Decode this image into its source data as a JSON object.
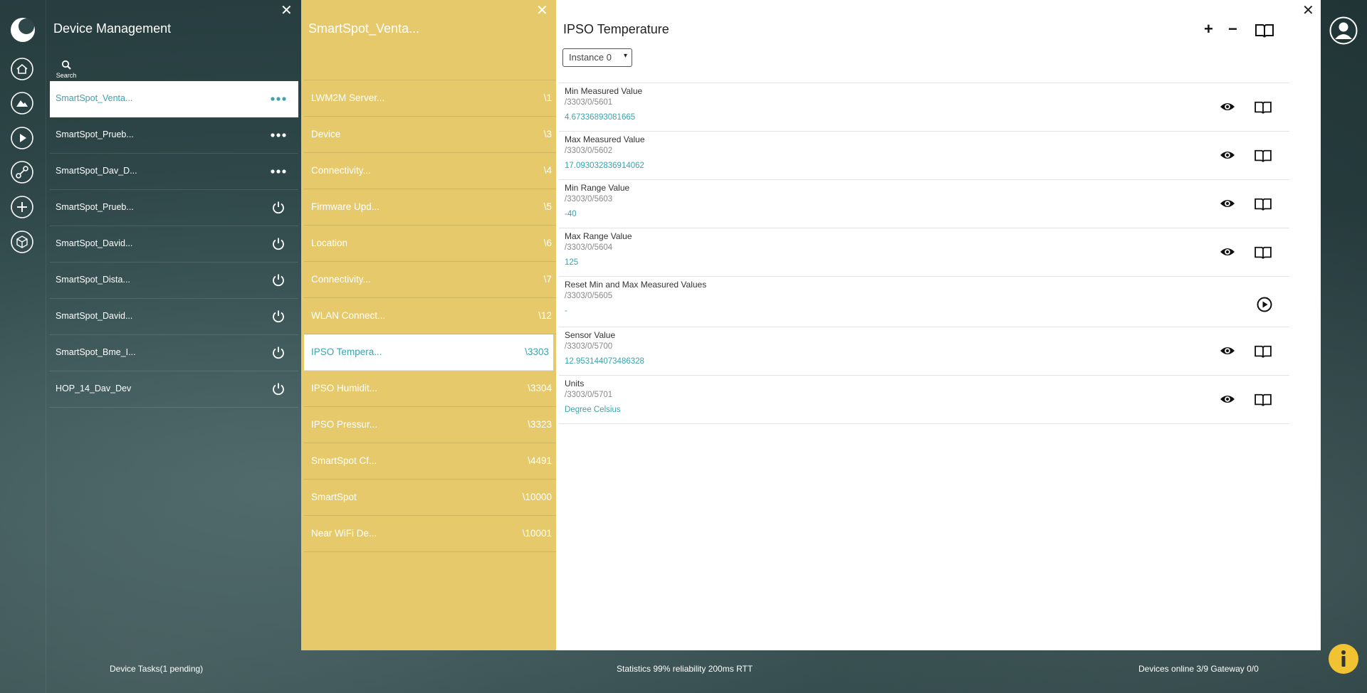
{
  "device_panel": {
    "title": "Device Management",
    "search_label": "Search",
    "devices": [
      {
        "name": "SmartSpot_Venta...",
        "action": "more",
        "selected": true
      },
      {
        "name": "SmartSpot_Prueb...",
        "action": "more"
      },
      {
        "name": "SmartSpot_Dav_D...",
        "action": "more"
      },
      {
        "name": "SmartSpot_Prueb...",
        "action": "power"
      },
      {
        "name": "SmartSpot_David...",
        "action": "power"
      },
      {
        "name": "SmartSpot_Dista...",
        "action": "power"
      },
      {
        "name": "SmartSpot_David...",
        "action": "power"
      },
      {
        "name": "SmartSpot_Bme_I...",
        "action": "power"
      },
      {
        "name": "HOP_14_Dav_Dev",
        "action": "power"
      }
    ]
  },
  "object_panel": {
    "title": "SmartSpot_Venta...",
    "objects": [
      {
        "name": "LWM2M Server...",
        "id": "\\1"
      },
      {
        "name": "Device",
        "id": "\\3"
      },
      {
        "name": "Connectivity...",
        "id": "\\4"
      },
      {
        "name": "Firmware Upd...",
        "id": "\\5"
      },
      {
        "name": "Location",
        "id": "\\6"
      },
      {
        "name": "Connectivity...",
        "id": "\\7"
      },
      {
        "name": "WLAN Connect...",
        "id": "\\12"
      },
      {
        "name": "IPSO Tempera...",
        "id": "\\3303",
        "selected": true
      },
      {
        "name": "IPSO Humidit...",
        "id": "\\3304"
      },
      {
        "name": "IPSO Pressur...",
        "id": "\\3323"
      },
      {
        "name": "SmartSpot Cf...",
        "id": "\\4491"
      },
      {
        "name": "SmartSpot",
        "id": "\\10000"
      },
      {
        "name": "Near WiFi De...",
        "id": "\\10001"
      }
    ]
  },
  "resource_panel": {
    "title": "IPSO Temperature",
    "add_label": "+",
    "remove_label": "−",
    "instance_select": "Instance 0",
    "resources": [
      {
        "name": "Min Measured Value",
        "path": "/3303/0/5601",
        "value": "4.67336893081665",
        "type": "read"
      },
      {
        "name": "Max Measured Value",
        "path": "/3303/0/5602",
        "value": "17.093032836914062",
        "type": "read"
      },
      {
        "name": "Min Range Value",
        "path": "/3303/0/5603",
        "value": "-40",
        "type": "read"
      },
      {
        "name": "Max Range Value",
        "path": "/3303/0/5604",
        "value": "125",
        "type": "read"
      },
      {
        "name": "Reset Min and Max Measured Values",
        "path": "/3303/0/5605",
        "value": "-",
        "type": "execute"
      },
      {
        "name": "Sensor Value",
        "path": "/3303/0/5700",
        "value": "12.953144073486328",
        "type": "read"
      },
      {
        "name": "Units",
        "path": "/3303/0/5701",
        "value": "Degree Celsius",
        "type": "read"
      }
    ]
  },
  "status_bar": {
    "tasks": "Device Tasks(1 pending)",
    "statistics": "Statistics 99% reliability 200ms RTT",
    "devices_online": "Devices online 3/9 Gateway 0/0"
  },
  "colors": {
    "accent": "#3aa3ad",
    "object_panel_bg": "#e5c96a",
    "info_button": "#f1c232"
  },
  "close_glyph": "✕"
}
